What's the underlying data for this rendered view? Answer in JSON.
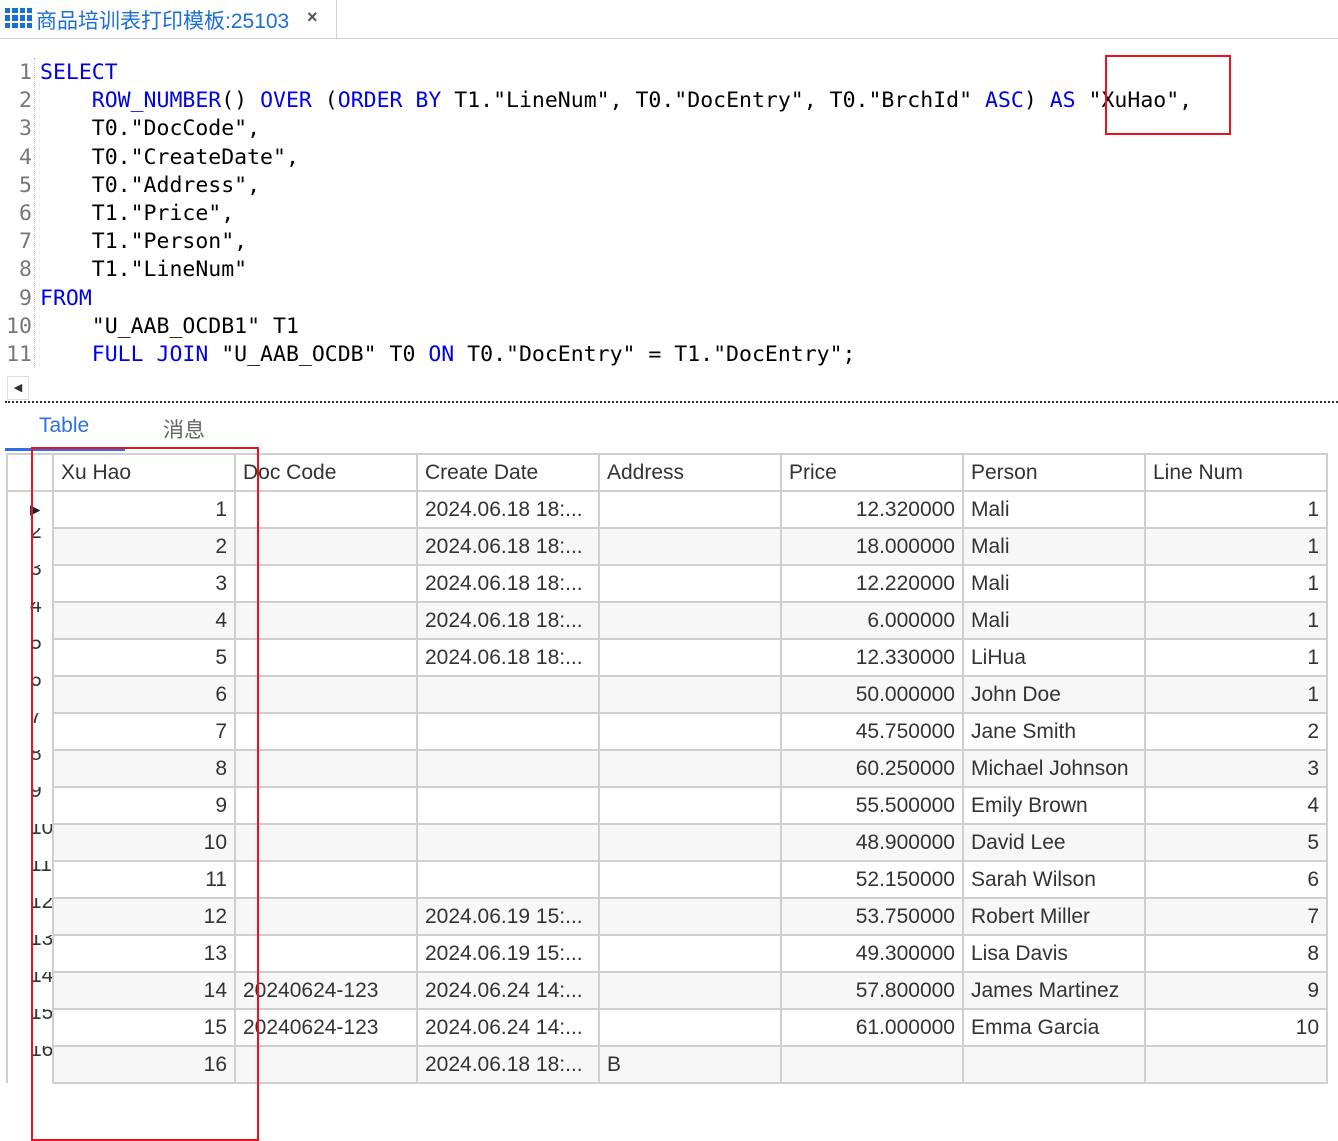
{
  "tab": {
    "title": "商品培训表打印模板:25103",
    "icon": "grid-icon",
    "close": "×"
  },
  "code": [
    [
      [
        "kw",
        "SELECT"
      ]
    ],
    [
      [
        "",
        "    "
      ],
      [
        "kw",
        "ROW_NUMBER"
      ],
      [
        "",
        "() "
      ],
      [
        "kw",
        "OVER"
      ],
      [
        "",
        " ("
      ],
      [
        "kw",
        "ORDER BY"
      ],
      [
        "",
        " T1.\"LineNum\", T0.\"DocEntry\", T0.\"BrchId\" "
      ],
      [
        "kw",
        "ASC"
      ],
      [
        "",
        ") "
      ],
      [
        "kw",
        "AS"
      ],
      [
        "",
        " \"XuHao\","
      ]
    ],
    [
      [
        "",
        "    T0.\"DocCode\","
      ]
    ],
    [
      [
        "",
        "    T0.\"CreateDate\","
      ]
    ],
    [
      [
        "",
        "    T0.\"Address\","
      ]
    ],
    [
      [
        "",
        "    T1.\"Price\","
      ]
    ],
    [
      [
        "",
        "    T1.\"Person\","
      ]
    ],
    [
      [
        "",
        "    T1.\"LineNum\""
      ]
    ],
    [
      [
        "kw",
        "FROM"
      ]
    ],
    [
      [
        "",
        "    \"U_AAB_OCDB1\" T1"
      ]
    ],
    [
      [
        "",
        "    "
      ],
      [
        "kw",
        "FULL JOIN"
      ],
      [
        "",
        " \"U_AAB_OCDB\" T0 "
      ],
      [
        "kw",
        "ON"
      ],
      [
        "",
        " T0.\"DocEntry\" = T1.\"DocEntry\";"
      ]
    ]
  ],
  "result_tabs": [
    {
      "label": "Table",
      "active": true
    },
    {
      "label": "消息",
      "active": false
    }
  ],
  "table": {
    "columns": [
      "Xu Hao",
      "Doc Code",
      "Create Date",
      "Address",
      "Price",
      "Person",
      "Line Num"
    ],
    "rows": [
      [
        "1",
        "",
        "2024.06.18 18:...",
        "",
        "12.320000",
        "Mali",
        "1"
      ],
      [
        "2",
        "",
        "2024.06.18 18:...",
        "",
        "18.000000",
        "Mali",
        "1"
      ],
      [
        "3",
        "",
        "2024.06.18 18:...",
        "",
        "12.220000",
        "Mali",
        "1"
      ],
      [
        "4",
        "",
        "2024.06.18 18:...",
        "",
        "6.000000",
        "Mali",
        "1"
      ],
      [
        "5",
        "",
        "2024.06.18 18:...",
        "",
        "12.330000",
        "LiHua",
        "1"
      ],
      [
        "6",
        "",
        "",
        "",
        "50.000000",
        "John Doe",
        "1"
      ],
      [
        "7",
        "",
        "",
        "",
        "45.750000",
        "Jane Smith",
        "2"
      ],
      [
        "8",
        "",
        "",
        "",
        "60.250000",
        "Michael Johnson",
        "3"
      ],
      [
        "9",
        "",
        "",
        "",
        "55.500000",
        "Emily Brown",
        "4"
      ],
      [
        "10",
        "",
        "",
        "",
        "48.900000",
        "David Lee",
        "5"
      ],
      [
        "11",
        "",
        "",
        "",
        "52.150000",
        "Sarah Wilson",
        "6"
      ],
      [
        "12",
        "",
        "2024.06.19 15:...",
        "",
        "53.750000",
        "Robert Miller",
        "7"
      ],
      [
        "13",
        "",
        "2024.06.19 15:...",
        "",
        "49.300000",
        "Lisa Davis",
        "8"
      ],
      [
        "14",
        "20240624-123",
        "2024.06.24 14:...",
        "",
        "57.800000",
        "James Martinez",
        "9"
      ],
      [
        "15",
        "20240624-123",
        "2024.06.24 14:...",
        "",
        "61.000000",
        "Emma Garcia",
        "10"
      ],
      [
        "16",
        "",
        "2024.06.18 18:...",
        "B",
        "",
        "",
        ""
      ]
    ]
  },
  "colors": {
    "keyword": "#0000e6",
    "accent": "#1a6fd6",
    "highlight": "#e8131f"
  }
}
